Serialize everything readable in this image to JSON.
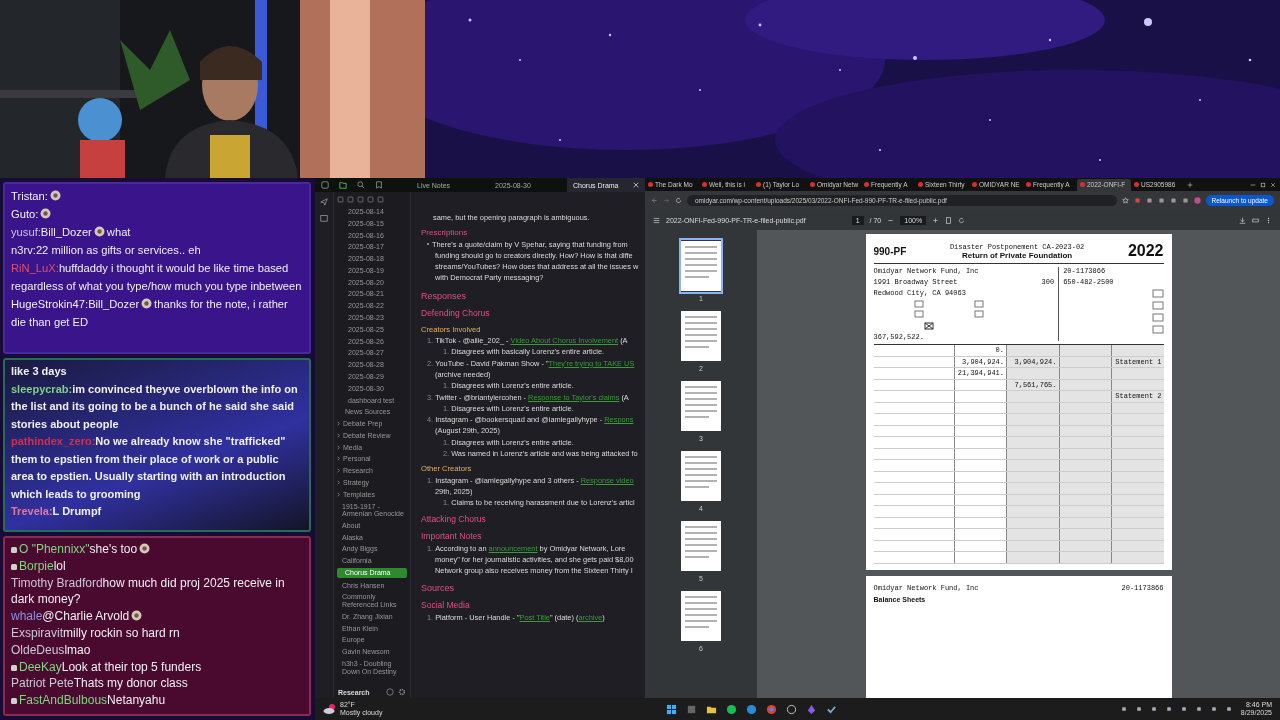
{
  "chat_panels": [
    {
      "kind": "purple",
      "messages": [
        {
          "user": "Tristan:",
          "color": "#f2f2f2",
          "segments": [
            {
              "kind": "emote"
            }
          ]
        },
        {
          "user": "Guto:",
          "color": "#f2f2f2",
          "segments": [
            {
              "kind": "emote"
            }
          ]
        },
        {
          "user": "yusuf:",
          "color": "#c8c8d8",
          "segments": [
            {
              "kind": "text",
              "text": "Bill_Dozer"
            },
            {
              "kind": "emote"
            },
            {
              "kind": "text",
              "text": "what"
            }
          ]
        },
        {
          "user": "n3rv:",
          "color": "#e8e8f0",
          "segments": [
            {
              "kind": "text",
              "text": "22 million as gifts or services.. eh"
            }
          ]
        },
        {
          "user": "RiN_LuX:",
          "color": "#e0506a",
          "segments": [
            {
              "kind": "text",
              "text": "huffdaddy i thought it would be like time based regardless of what you type/how much you type inbetween"
            }
          ]
        },
        {
          "user": "HugeStrokin47:",
          "color": "#f2f2f2",
          "segments": [
            {
              "kind": "text",
              "text": "Bill_Dozer"
            },
            {
              "kind": "emote"
            },
            {
              "kind": "text",
              "text": "thanks for the note, i rather die than get ED"
            }
          ]
        }
      ]
    },
    {
      "kind": "teal",
      "messages": [
        {
          "segments": [
            {
              "kind": "text",
              "text": "like 3 days"
            }
          ]
        },
        {
          "user": "sleepycrab:",
          "color": "#7fd08a",
          "segments": [
            {
              "kind": "text",
              "text": "im convinced theyve overblown the info on the list and its going to be a bunch of he said she said stories about people"
            }
          ]
        },
        {
          "user": "pathindex_zero:",
          "color": "#d0304c",
          "segments": [
            {
              "kind": "text",
              "text": "No we already know she \"trafficked\" them to epstien from their place of work or a public area to epstien. Usually starting with an introduction which leads to grooming"
            }
          ]
        },
        {
          "user": "Trevela:",
          "color": "#e07a9a",
          "segments": [
            {
              "kind": "text",
              "text": "L Drumpf"
            }
          ]
        }
      ]
    },
    {
      "kind": "maroon",
      "messages": [
        {
          "user": "O \"Phennixx\"",
          "color": "#7ed67e",
          "badge": true,
          "segments": [
            {
              "kind": "text",
              "text": "she's too"
            },
            {
              "kind": "emote"
            }
          ]
        },
        {
          "user": "Borpie",
          "color": "#7ed67e",
          "badge": true,
          "segments": [
            {
              "kind": "text",
              "text": "lol"
            }
          ]
        },
        {
          "user": "Timothy Bradford",
          "color": "#c9c9d6",
          "badge": false,
          "segments": [
            {
              "kind": "text",
              "text": "how much did proj 2025 receive in dark money?"
            }
          ]
        },
        {
          "user": "whale",
          "color": "#8a94e0",
          "badge": false,
          "segments": [
            {
              "kind": "text",
              "text": "@Charlie Arvold"
            },
            {
              "kind": "emote"
            }
          ]
        },
        {
          "user": "Exspiravit",
          "color": "#c9c9d6",
          "badge": false,
          "segments": [
            {
              "kind": "text",
              "text": "milly rockin so hard rn"
            }
          ]
        },
        {
          "user": "OldeDeus",
          "color": "#c9c9d6",
          "badge": false,
          "segments": [
            {
              "kind": "text",
              "text": "lmao"
            }
          ]
        },
        {
          "user": "DeeKay",
          "color": "#7ed67e",
          "badge": true,
          "segments": [
            {
              "kind": "text",
              "text": "Look at their top 5 funders"
            }
          ]
        },
        {
          "user": "Patriot Pete",
          "color": "#c9c9d6",
          "badge": false,
          "segments": [
            {
              "kind": "text",
              "text": "Thats my donor class"
            }
          ]
        },
        {
          "user": "FastAndBulbous",
          "color": "#7ed67e",
          "badge": true,
          "segments": [
            {
              "kind": "text",
              "text": "Netanyahu"
            }
          ]
        }
      ]
    }
  ],
  "notes_app": {
    "tabs": [
      {
        "label": "Live Notes",
        "selected": false
      },
      {
        "label": "2025-08-30",
        "selected": false
      },
      {
        "label": "Chorus Drama",
        "selected": true
      }
    ],
    "sidebar": {
      "nested_items": [
        "2025-08-14",
        "2025-08-15",
        "2025-08-16",
        "2025-08-17",
        "2025-08-18",
        "2025-08-19",
        "2025-08-20",
        "2025-08-21",
        "2025-08-22",
        "2025-08-23",
        "2025-08-25",
        "2025-08-26",
        "2025-08-27",
        "2025-08-28",
        "2025-08-29",
        "2025-08-30",
        "dashboard test"
      ],
      "items": [
        {
          "label": "News Sources",
          "kind": "file",
          "selected": false
        },
        {
          "label": "Debate Prep",
          "kind": "folder",
          "selected": false
        },
        {
          "label": "Debate Review",
          "kind": "folder",
          "selected": false
        },
        {
          "label": "Media",
          "kind": "folder",
          "selected": false
        },
        {
          "label": "Personal",
          "kind": "folder",
          "selected": false
        },
        {
          "label": "Research",
          "kind": "folder",
          "selected": false
        },
        {
          "label": "Strategy",
          "kind": "folder",
          "selected": false
        },
        {
          "label": "Templates",
          "kind": "folder",
          "selected": false
        },
        {
          "label": "1915-1917 - Armenian Genocide",
          "kind": "file",
          "selected": false
        },
        {
          "label": "About",
          "kind": "file",
          "selected": false
        },
        {
          "label": "Alaska",
          "kind": "file",
          "selected": false
        },
        {
          "label": "Andy Biggs",
          "kind": "file",
          "selected": false
        },
        {
          "label": "California",
          "kind": "file",
          "selected": false
        },
        {
          "label": "Chorus Drama",
          "kind": "file",
          "selected": true
        },
        {
          "label": "Chris Hansen",
          "kind": "file",
          "selected": false
        },
        {
          "label": "Commonly Referenced Links",
          "kind": "file",
          "selected": false
        },
        {
          "label": "Dr. Zhang Jixian",
          "kind": "file",
          "selected": false
        },
        {
          "label": "Ethan Klein",
          "kind": "file",
          "selected": false
        },
        {
          "label": "Europe",
          "kind": "file",
          "selected": false
        },
        {
          "label": "Gavin Newsom",
          "kind": "file",
          "selected": false
        },
        {
          "label": "h3h3 - Doubling Down On Destiny",
          "kind": "file",
          "selected": false
        }
      ],
      "vault": "Research"
    },
    "lines": [
      {
        "kind": "para",
        "parts": [
          {
            "text": "same, but the opening paragraph is ambiguous.",
            "link": false
          }
        ]
      },
      {
        "kind": "h4",
        "parts": [
          {
            "text": "Prescriptions",
            "link": false
          }
        ]
      },
      {
        "kind": "bullet",
        "parts": [
          {
            "text": "There's a quote/claim by V Spehar, saying that funding from",
            "link": false
          }
        ]
      },
      {
        "kind": "cont",
        "parts": [
          {
            "text": "funding should go to creators directly. How? How is that diffe",
            "link": false
          }
        ]
      },
      {
        "kind": "cont",
        "parts": [
          {
            "text": "streams/YouTubes? How does that address at all the issues w",
            "link": false
          }
        ]
      },
      {
        "kind": "cont",
        "parts": [
          {
            "text": "with Democrat Party messaging?",
            "link": false
          }
        ]
      },
      {
        "kind": "h2",
        "parts": [
          {
            "text": "Responses",
            "link": false
          }
        ]
      },
      {
        "kind": "h3",
        "parts": [
          {
            "text": "Defending Chorus",
            "link": false
          }
        ]
      },
      {
        "kind": "h5",
        "parts": [
          {
            "text": "Creators Involved",
            "link": false
          }
        ]
      },
      {
        "kind": "item",
        "number": "1.",
        "parts": [
          {
            "text": "TikTok - @allie_202_ - ",
            "link": false
          },
          {
            "text": "Video About Chorus Involvement",
            "link": true
          },
          {
            "text": " (A",
            "link": false
          }
        ]
      },
      {
        "kind": "sub",
        "number": "1.",
        "parts": [
          {
            "text": "Disagrees with basically Lorenz's entire article.",
            "link": false
          }
        ]
      },
      {
        "kind": "item",
        "number": "2.",
        "parts": [
          {
            "text": "YouTube - David Pakman Show - \"",
            "link": false
          },
          {
            "text": "They're trying to TAKE US",
            "link": true
          }
        ]
      },
      {
        "kind": "cont",
        "parts": [
          {
            "text": "(archive needed)",
            "link": false
          }
        ]
      },
      {
        "kind": "sub",
        "number": "1.",
        "parts": [
          {
            "text": "Disagrees with Lorenz's entire article.",
            "link": false
          }
        ]
      },
      {
        "kind": "item",
        "number": "3.",
        "parts": [
          {
            "text": "Twitter - @briantylercohen - ",
            "link": false
          },
          {
            "text": "Response to Taylor's claims",
            "link": true
          },
          {
            "text": " (A",
            "link": false
          }
        ]
      },
      {
        "kind": "sub",
        "number": "1.",
        "parts": [
          {
            "text": "Disagrees with Lorenz's entire article.",
            "link": false
          }
        ]
      },
      {
        "kind": "item",
        "number": "4.",
        "parts": [
          {
            "text": "Instagram - @bookersquad and @iamlegallyhype - ",
            "link": false
          },
          {
            "text": "Respons",
            "link": true
          }
        ]
      },
      {
        "kind": "cont",
        "parts": [
          {
            "text": "(August 29th, 2025)",
            "link": false
          }
        ]
      },
      {
        "kind": "sub",
        "number": "1.",
        "parts": [
          {
            "text": "Disagrees with Lorenz's entire article.",
            "link": false
          }
        ]
      },
      {
        "kind": "sub",
        "number": "2.",
        "parts": [
          {
            "text": "Was named in Lorenz's article and was being attacked fo",
            "link": false
          }
        ]
      },
      {
        "kind": "h5",
        "parts": [
          {
            "text": "Other Creators",
            "link": false
          }
        ]
      },
      {
        "kind": "item",
        "number": "1.",
        "parts": [
          {
            "text": "Instagram - @iamlegallyhype and 3 others - ",
            "link": false
          },
          {
            "text": "Response video",
            "link": true
          }
        ]
      },
      {
        "kind": "cont",
        "parts": [
          {
            "text": "29th, 2025)",
            "link": false
          }
        ]
      },
      {
        "kind": "sub",
        "number": "1.",
        "parts": [
          {
            "text": "Claims to be receiving harassment due to Lorenz's articl",
            "link": false
          }
        ]
      },
      {
        "kind": "h3",
        "parts": [
          {
            "text": "Attacking Chorus",
            "link": false
          }
        ]
      },
      {
        "kind": "h3",
        "parts": [
          {
            "text": "Important Notes",
            "link": false
          }
        ]
      },
      {
        "kind": "item",
        "number": "1.",
        "parts": [
          {
            "text": "According to an ",
            "link": false
          },
          {
            "text": "announcement",
            "link": true
          },
          {
            "text": " by Omidyar Network, Lore",
            "link": false
          }
        ]
      },
      {
        "kind": "cont",
        "parts": [
          {
            "text": "money\" for her journalistic activities, and she gets paid $8,00",
            "link": false
          }
        ]
      },
      {
        "kind": "cont",
        "parts": [
          {
            "text": "Network group also receives money from the Sixteen Thirty I",
            "link": false
          }
        ]
      },
      {
        "kind": "h2",
        "parts": [
          {
            "text": "Sources",
            "link": false
          }
        ]
      },
      {
        "kind": "h3",
        "parts": [
          {
            "text": "Social Media",
            "link": false
          }
        ]
      },
      {
        "kind": "item",
        "number": "1.",
        "parts": [
          {
            "text": "Platform - User Handle - \"",
            "link": false
          },
          {
            "text": "Post Title",
            "link": true
          },
          {
            "text": "\" (date) (",
            "link": false
          },
          {
            "text": "archive",
            "link": true
          },
          {
            "text": ")",
            "link": false
          }
        ]
      }
    ]
  },
  "browser": {
    "tabs": [
      {
        "label": "The Dark Mo",
        "selected": false
      },
      {
        "label": "Well, this is i",
        "selected": false
      },
      {
        "label": "(1) Taylor Lo",
        "selected": false
      },
      {
        "label": "Omidyar Netw",
        "selected": false
      },
      {
        "label": "Frequently A",
        "selected": false
      },
      {
        "label": "Sixteen Thirty",
        "selected": false
      },
      {
        "label": "OMIDYAR NE",
        "selected": false
      },
      {
        "label": "Frequently A",
        "selected": false
      },
      {
        "label": "2022-ONFI-F",
        "selected": true
      },
      {
        "label": "US2905986",
        "selected": false
      }
    ],
    "url": "omidyar.com/wp-content/uploads/2025/03/2022-ONFI-Fed-990-PF-TR-e-filed-public.pdf",
    "update_button": "Relaunch to update",
    "pdf": {
      "filename": "2022-ONFI-Fed-990-PF-TR-e-filed-public.pdf",
      "page": "1",
      "page_count": "/ 70",
      "zoom": "100%",
      "thumbnails": [
        {
          "number": "1",
          "selected": true
        },
        {
          "number": "2",
          "selected": false
        },
        {
          "number": "3",
          "selected": false
        },
        {
          "number": "4",
          "selected": false
        },
        {
          "number": "5",
          "selected": false
        },
        {
          "number": "6",
          "selected": false
        }
      ],
      "page1": {
        "header": "Disaster Postponement CA-2023-02",
        "form": "990-PF",
        "title": "Return of Private Foundation",
        "year": "2022",
        "org_name": "Omidyar Network Fund, Inc",
        "street": "1991 Broadway Street",
        "room": "300",
        "city": "Redwood City, CA 94063",
        "ein": "20-1173866",
        "phone": "650-482-2500",
        "assets": "367,592,522.",
        "rows": [
          [
            "0.",
            "",
            "",
            ""
          ],
          [
            "3,904,924.",
            "3,904,924.",
            "",
            "Statement 1"
          ],
          [
            "21,394,941.",
            "",
            "",
            ""
          ],
          [
            "",
            "7,561,765.",
            "",
            ""
          ],
          [
            "",
            "",
            "",
            "Statement 2"
          ]
        ]
      },
      "page2": {
        "org_name": "Omidyar Network Fund, Inc",
        "ein": "20-1173866",
        "title": "Balance Sheets"
      }
    }
  },
  "taskbar": {
    "temperature": "82°F",
    "weather": "Mostly cloudy",
    "time": "8:46 PM",
    "date": "8/29/2025"
  }
}
